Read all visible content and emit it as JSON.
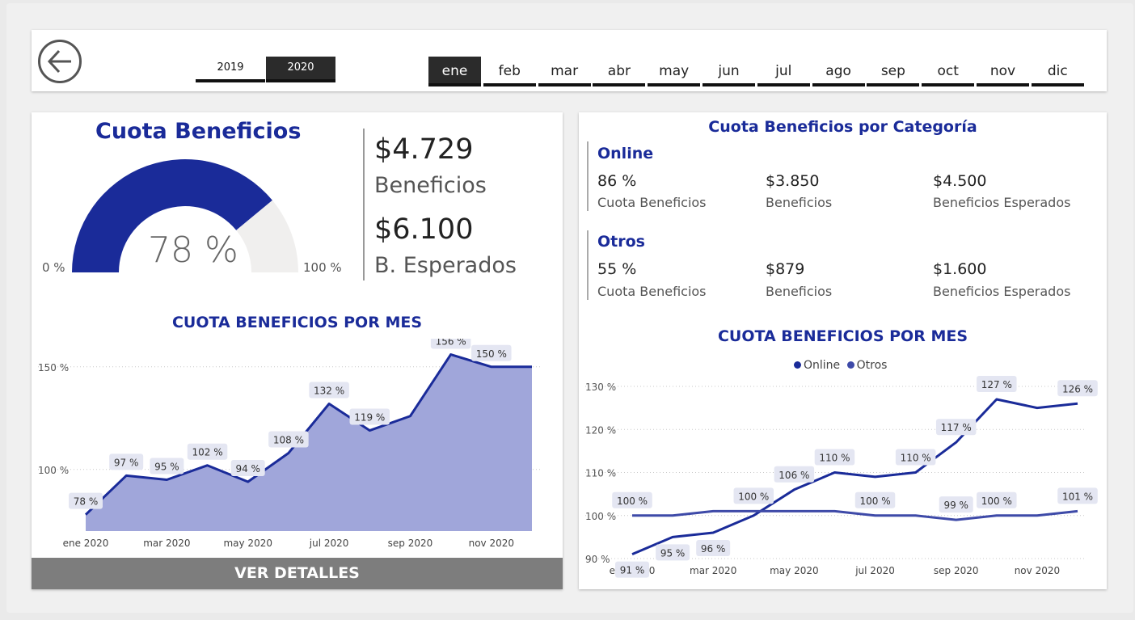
{
  "topbar": {
    "years": [
      {
        "label": "2019",
        "active": false
      },
      {
        "label": "2020",
        "active": true
      }
    ],
    "months": [
      {
        "label": "ene",
        "active": true
      },
      {
        "label": "feb",
        "active": false
      },
      {
        "label": "mar",
        "active": false
      },
      {
        "label": "abr",
        "active": false
      },
      {
        "label": "may",
        "active": false
      },
      {
        "label": "jun",
        "active": false
      },
      {
        "label": "jul",
        "active": false
      },
      {
        "label": "ago",
        "active": false
      },
      {
        "label": "sep",
        "active": false
      },
      {
        "label": "oct",
        "active": false
      },
      {
        "label": "nov",
        "active": false
      },
      {
        "label": "dic",
        "active": false
      }
    ]
  },
  "gauge": {
    "title": "Cuota Beneficios",
    "value_text": "78 %",
    "fraction": 0.78,
    "min_label": "0 %",
    "max_label": "100 %",
    "fill_color": "#1a2b99",
    "track_color": "#f0efee"
  },
  "kpis": [
    {
      "value": "$4.729",
      "label": "Beneficios"
    },
    {
      "value": "$6.100",
      "label": "B. Esperados"
    }
  ],
  "left_chart_title": "CUOTA BENEFICIOS POR MES",
  "ver_detalles": "VER DETALLES",
  "categories_title": "Cuota Beneficios por Categoría",
  "categories": [
    {
      "name": "Online",
      "metrics": [
        {
          "value": "86 %",
          "label": "Cuota Beneficios"
        },
        {
          "value": "$3.850",
          "label": "Beneficios"
        },
        {
          "value": "$4.500",
          "label": "Beneficios Esperados"
        }
      ]
    },
    {
      "name": "Otros",
      "metrics": [
        {
          "value": "55 %",
          "label": "Cuota Beneficios"
        },
        {
          "value": "$879",
          "label": "Beneficios"
        },
        {
          "value": "$1.600",
          "label": "Beneficios Esperados"
        }
      ]
    }
  ],
  "right_chart_title": "CUOTA BENEFICIOS POR MES",
  "chart_data": [
    {
      "type": "area",
      "title": "CUOTA BENEFICIOS POR MES",
      "x": [
        "ene 2020",
        "feb 2020",
        "mar 2020",
        "abr 2020",
        "may 2020",
        "jun 2020",
        "jul 2020",
        "ago 2020",
        "sep 2020",
        "oct 2020",
        "nov 2020",
        "dic 2020"
      ],
      "x_tick_labels": [
        "ene 2020",
        "mar 2020",
        "may 2020",
        "jul 2020",
        "sep 2020",
        "nov 2020"
      ],
      "series": [
        {
          "values": [
            78,
            97,
            95,
            102,
            94,
            108,
            132,
            119,
            126,
            156,
            150,
            150
          ],
          "color": "#1a2b99",
          "fill": "#a0a6da"
        }
      ],
      "data_labels": [
        "78 %",
        "97 %",
        "95 %",
        "102 %",
        "94 %",
        "108 %",
        "132 %",
        "119 %",
        null,
        "156 %",
        "150 %",
        null
      ],
      "y_ticks": [
        {
          "value": 100,
          "label": "100 %"
        },
        {
          "value": 150,
          "label": "150 %"
        }
      ],
      "ylim": [
        70,
        157
      ],
      "grid": true
    },
    {
      "type": "line",
      "title": "CUOTA BENEFICIOS POR MES",
      "x": [
        "ene 2020",
        "feb 2020",
        "mar 2020",
        "abr 2020",
        "may 2020",
        "jun 2020",
        "jul 2020",
        "ago 2020",
        "sep 2020",
        "oct 2020",
        "nov 2020",
        "dic 2020"
      ],
      "x_tick_labels": [
        "ene 2020",
        "mar 2020",
        "may 2020",
        "jul 2020",
        "sep 2020",
        "nov 2020"
      ],
      "legend_position": "top-center",
      "series": [
        {
          "name": "Online",
          "color": "#1a2b99",
          "values": [
            91,
            95,
            96,
            100,
            106,
            110,
            109,
            110,
            117,
            127,
            125,
            126
          ],
          "data_labels": [
            "91 %",
            "95 %",
            "96 %",
            null,
            "106 %",
            "110 %",
            null,
            "110 %",
            "117 %",
            "127 %",
            null,
            "126 %"
          ]
        },
        {
          "name": "Otros",
          "color": "#3e4aa8",
          "values": [
            100,
            100,
            101,
            101,
            101,
            101,
            100,
            100,
            99,
            100,
            100,
            101
          ],
          "data_labels": [
            "100 %",
            null,
            null,
            "100 %",
            null,
            null,
            "100 %",
            null,
            "99 %",
            "100 %",
            null,
            "101 %"
          ]
        }
      ],
      "y_ticks": [
        {
          "value": 90,
          "label": "90 %"
        },
        {
          "value": 100,
          "label": "100 %"
        },
        {
          "value": 110,
          "label": "110 %"
        },
        {
          "value": 120,
          "label": "120 %"
        },
        {
          "value": 130,
          "label": "130 %"
        }
      ],
      "ylim": [
        90,
        130
      ],
      "grid": true
    }
  ]
}
